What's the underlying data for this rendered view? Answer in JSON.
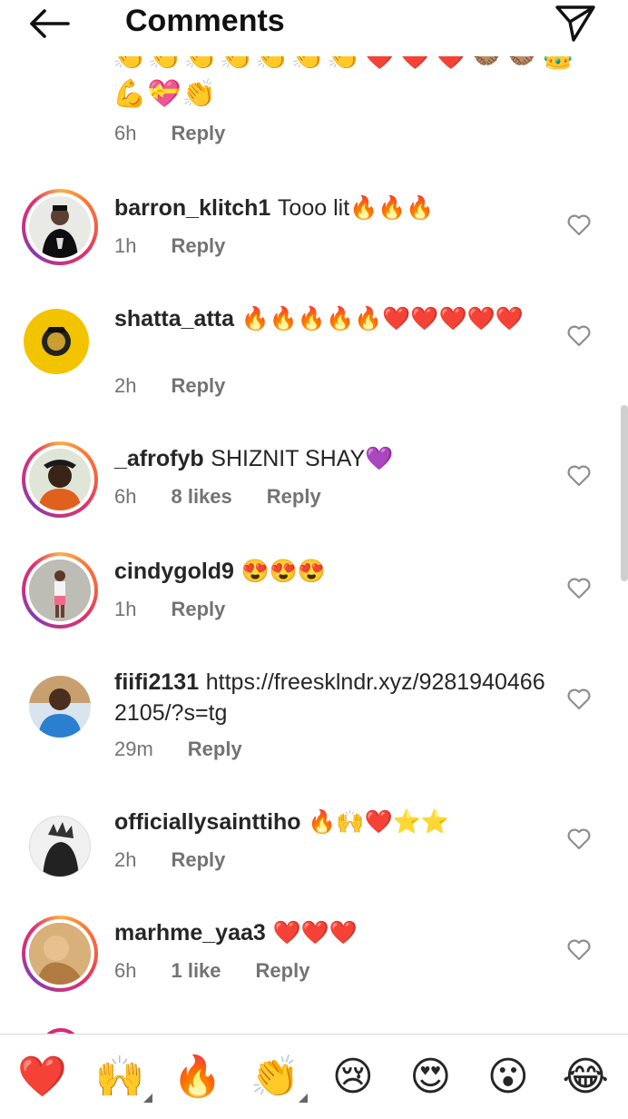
{
  "header": {
    "title": "Comments"
  },
  "partial_comment": {
    "line1": "👏👏👏👏👏👏👏❤️❤️❤️🤝🏽🤝🏽👑",
    "line2": "💪💝👏",
    "time": "6h",
    "reply": "Reply"
  },
  "comments": [
    {
      "username": "barron_klitch1",
      "text": "Tooo lit🔥🔥🔥",
      "time": "1h",
      "likes": "",
      "reply": "Reply"
    },
    {
      "username": "shatta_atta",
      "text": "🔥🔥🔥🔥🔥❤️❤️❤️❤️❤️",
      "time": "2h",
      "likes": "",
      "reply": "Reply"
    },
    {
      "username": "_afrofyb",
      "text": "SHIZNIT SHAY💜",
      "time": "6h",
      "likes": "8 likes",
      "reply": "Reply"
    },
    {
      "username": "cindygold9",
      "text": "😍😍😍",
      "time": "1h",
      "likes": "",
      "reply": "Reply"
    },
    {
      "username": "fiifi2131",
      "text": "https://freesklndr.xyz/92819404662105/?s=tg",
      "time": "29m",
      "likes": "",
      "reply": "Reply"
    },
    {
      "username": "officiallysainttiho",
      "text": "🔥🙌❤️⭐⭐",
      "time": "2h",
      "likes": "",
      "reply": "Reply"
    },
    {
      "username": "marhme_yaa3",
      "text": "❤️❤️❤️",
      "time": "6h",
      "likes": "1 like",
      "reply": "Reply"
    }
  ],
  "reactions": [
    "❤️",
    "🙌",
    "🔥",
    "👏",
    "😢",
    "😍",
    "😮",
    "😂"
  ]
}
